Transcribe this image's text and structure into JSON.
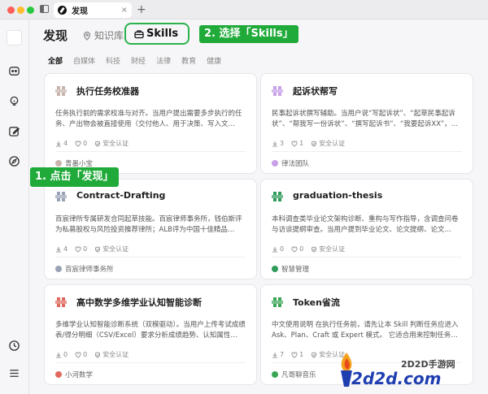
{
  "window": {
    "tab_title": "发现",
    "new_tab_symbol": "+",
    "close_symbol": "×"
  },
  "main": {
    "heading": "发现",
    "tabs": [
      {
        "label": "知识库"
      },
      {
        "label": "Skills"
      }
    ],
    "filters": [
      "全部",
      "自媒体",
      "科技",
      "财经",
      "法律",
      "教育",
      "健康"
    ]
  },
  "annotations": {
    "step2": "2. 选择「Skills」",
    "step1": "1. 点击「发现」"
  },
  "cards": [
    {
      "title": "执行任务校准器",
      "desc": "任务执行前的需求校准与对齐。当用户提出需要多步执行的任务、产出物会被直接使用（交付他人、用于决策、写入文…",
      "downloads": "4",
      "likes": "0",
      "badge": "安全认证",
      "author": "青墨小宝",
      "accent": "#c8b4ac"
    },
    {
      "title": "起诉状帮写",
      "desc": "民事起诉状撰写辅助。当用户说“写起诉状”、“起草民事起诉状”、“帮我写一份诉状”、“撰写起诉书”、“我要起诉XX”，…",
      "downloads": "3",
      "likes": "1",
      "badge": "安全认证",
      "author": "律法团队",
      "accent": "#c9a0e8"
    },
    {
      "title": "Contract-Drafting",
      "desc": "百宸律所专属研发合同起草技能。百宸律师事务所，钱伯斯评为私募股权与风险投资推荐律所；ALB评为中国十佳精品…",
      "downloads": "4",
      "likes": "0",
      "badge": "安全认证",
      "author": "百宸律师事务所",
      "accent": "#9aa3b5"
    },
    {
      "title": "graduation-thesis",
      "desc": "本科调查类毕业论文架构诊断、重构与写作指导，含调查问卷与访谈提纲审查。当用户提到毕业论文、论文提纲、论文…",
      "downloads": "0",
      "likes": "0",
      "badge": "安全认证",
      "author": "智慧管理",
      "accent": "#2f9a5a"
    },
    {
      "title": "高中数学多维学业认知智能诊断",
      "desc": "多维学业认知智能诊断系统（双模驱动）。当用户上传考试成绩表/得分明细（CSV/Excel）要求分析成绩趋势、认知属性…",
      "downloads": "0",
      "likes": "0",
      "badge": "安全认证",
      "author": "小河数学",
      "accent": "#e06a5f"
    },
    {
      "title": "Token省流",
      "desc": "中文使用说明 在执行任务前，请先让本 Skill 判断任务应进入 Ask、Plan、Craft 或 Expert 模式。 它适合用来控制任务…",
      "downloads": "7",
      "likes": "1",
      "badge": "安全认证",
      "author": "凡哥聊音乐",
      "accent": "#3aa655"
    }
  ],
  "watermark": {
    "top": "2D2D手游网",
    "main": "2d2d.com"
  }
}
